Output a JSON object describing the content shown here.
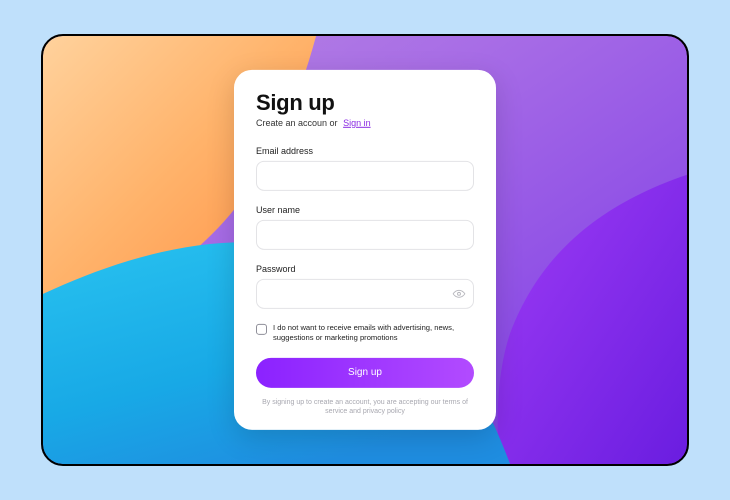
{
  "header": {
    "title": "Sign up",
    "subtitle_prefix": "Create an accoun or",
    "signin_link": "Sign in"
  },
  "fields": {
    "email": {
      "label": "Email address",
      "value": "",
      "placeholder": ""
    },
    "username": {
      "label": "User name",
      "value": "",
      "placeholder": ""
    },
    "password": {
      "label": "Password",
      "value": "",
      "placeholder": ""
    }
  },
  "optout": {
    "checked": false,
    "text": "I do not want to receive emails with advertising, news, suggestions or marketing promotions"
  },
  "submit": {
    "label": "Sign up"
  },
  "footnote": "By signing up to create an account, you are accepting our terms of service and privacy policy",
  "colors": {
    "accent_start": "#8b22ff",
    "accent_end": "#b24bff",
    "link": "#8a2be2"
  }
}
